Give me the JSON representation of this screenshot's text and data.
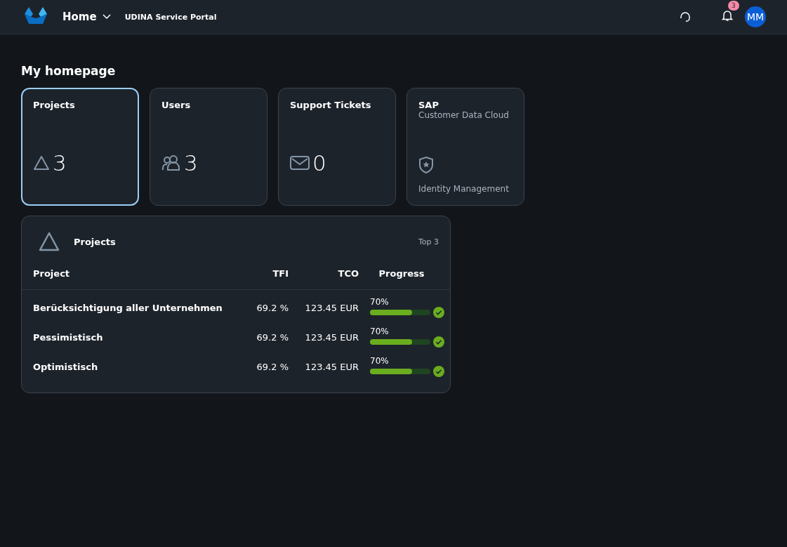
{
  "header": {
    "menu": "Home",
    "title": "UDINA Service Portal",
    "notifications_badge": "3",
    "avatar": "MM"
  },
  "page_title": "My homepage",
  "tiles": [
    {
      "kind": "count",
      "title": "Projects",
      "value": "3",
      "selected": true
    },
    {
      "kind": "count",
      "title": "Users",
      "value": "3",
      "selected": false
    },
    {
      "kind": "count",
      "title": "Support Tickets",
      "value": "0",
      "selected": false
    },
    {
      "kind": "app",
      "title": "SAP",
      "subtitle": "Customer Data Cloud",
      "footer": "Identity Management",
      "selected": false
    }
  ],
  "projects_card": {
    "title": "Projects",
    "info": "Top 3",
    "columns": [
      "Project",
      "TFI",
      "TCO",
      "Progress"
    ],
    "rows": [
      {
        "project": "Berücksichtigung aller Unternehmen",
        "tfi": "69.2 %",
        "tco": "123.45 EUR",
        "progress": "70%",
        "level": 0.7
      },
      {
        "project": "Pessimistisch",
        "tfi": "69.2 %",
        "tco": "123.45 EUR",
        "progress": "70%",
        "level": 0.7
      },
      {
        "project": "Optimistisch",
        "tfi": "69.2 %",
        "tco": "123.45 EUR",
        "progress": "70%",
        "level": 0.7
      }
    ]
  }
}
